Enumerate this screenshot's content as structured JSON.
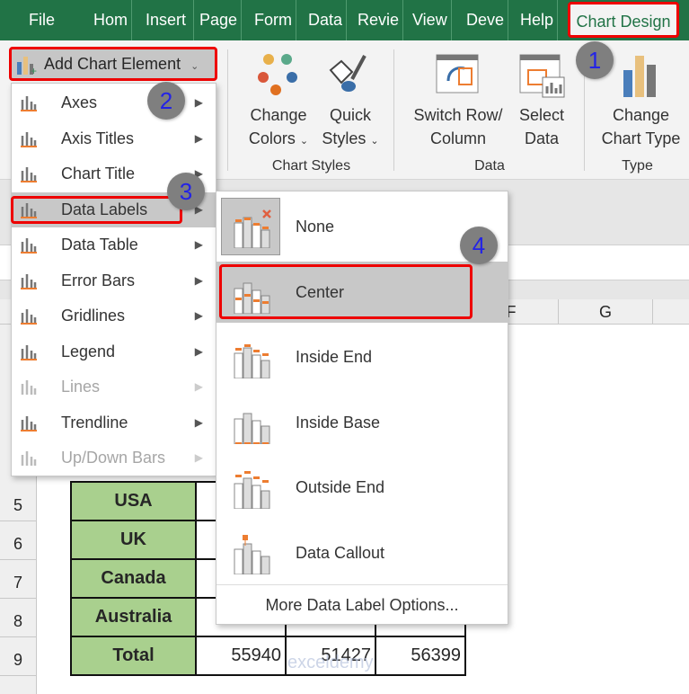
{
  "tabs": [
    "File",
    "Hom",
    "Insert",
    "Page",
    "Form",
    "Data",
    "Revie",
    "View",
    "Deve",
    "Help"
  ],
  "active_tab": "Chart Design",
  "ribbon": {
    "add_chart_element": "Add Chart Element",
    "change_colors": [
      "Change",
      "Colors"
    ],
    "quick_styles": [
      "Quick",
      "Styles"
    ],
    "switch_row_column": [
      "Switch Row/",
      "Column"
    ],
    "select_data": [
      "Select",
      "Data"
    ],
    "change_chart_type": [
      "Change",
      "Chart Type"
    ],
    "groups": [
      "Chart Styles",
      "Data",
      "Type"
    ]
  },
  "menu": {
    "items": [
      {
        "label": "Axes",
        "enabled": true
      },
      {
        "label": "Axis Titles",
        "enabled": true
      },
      {
        "label": "Chart Title",
        "enabled": true
      },
      {
        "label": "Data Labels",
        "enabled": true,
        "highlighted": true
      },
      {
        "label": "Data Table",
        "enabled": true
      },
      {
        "label": "Error Bars",
        "enabled": true
      },
      {
        "label": "Gridlines",
        "enabled": true
      },
      {
        "label": "Legend",
        "enabled": true
      },
      {
        "label": "Lines",
        "enabled": false
      },
      {
        "label": "Trendline",
        "enabled": true
      },
      {
        "label": "Up/Down Bars",
        "enabled": false
      }
    ]
  },
  "submenu": {
    "items": [
      "None",
      "Center",
      "Inside End",
      "Inside Base",
      "Outside End",
      "Data Callout"
    ],
    "highlighted": "Center",
    "more": "More Data Label Options..."
  },
  "columns": [
    "F",
    "G"
  ],
  "rows": [
    "5",
    "6",
    "7",
    "8",
    "9"
  ],
  "table": [
    {
      "label": "USA",
      "values": [
        "",
        "",
        ""
      ]
    },
    {
      "label": "UK",
      "values": [
        "",
        "",
        ""
      ]
    },
    {
      "label": "Canada",
      "values": [
        "",
        "",
        ""
      ]
    },
    {
      "label": "Australia",
      "values": [
        "",
        "",
        ""
      ]
    },
    {
      "label": "Total",
      "values": [
        "55940",
        "51427",
        "56399"
      ]
    }
  ],
  "badges": [
    "1",
    "2",
    "3",
    "4"
  ],
  "watermark": "exceldemy EXCEL · DATA · BI",
  "colors": {
    "excel_green": "#217346",
    "highlight": "#e00000",
    "badge": "#7f7f7f",
    "badge_text": "#2323e6",
    "label_fill": "#a9d08e",
    "accent_orange": "#ed7d31"
  }
}
